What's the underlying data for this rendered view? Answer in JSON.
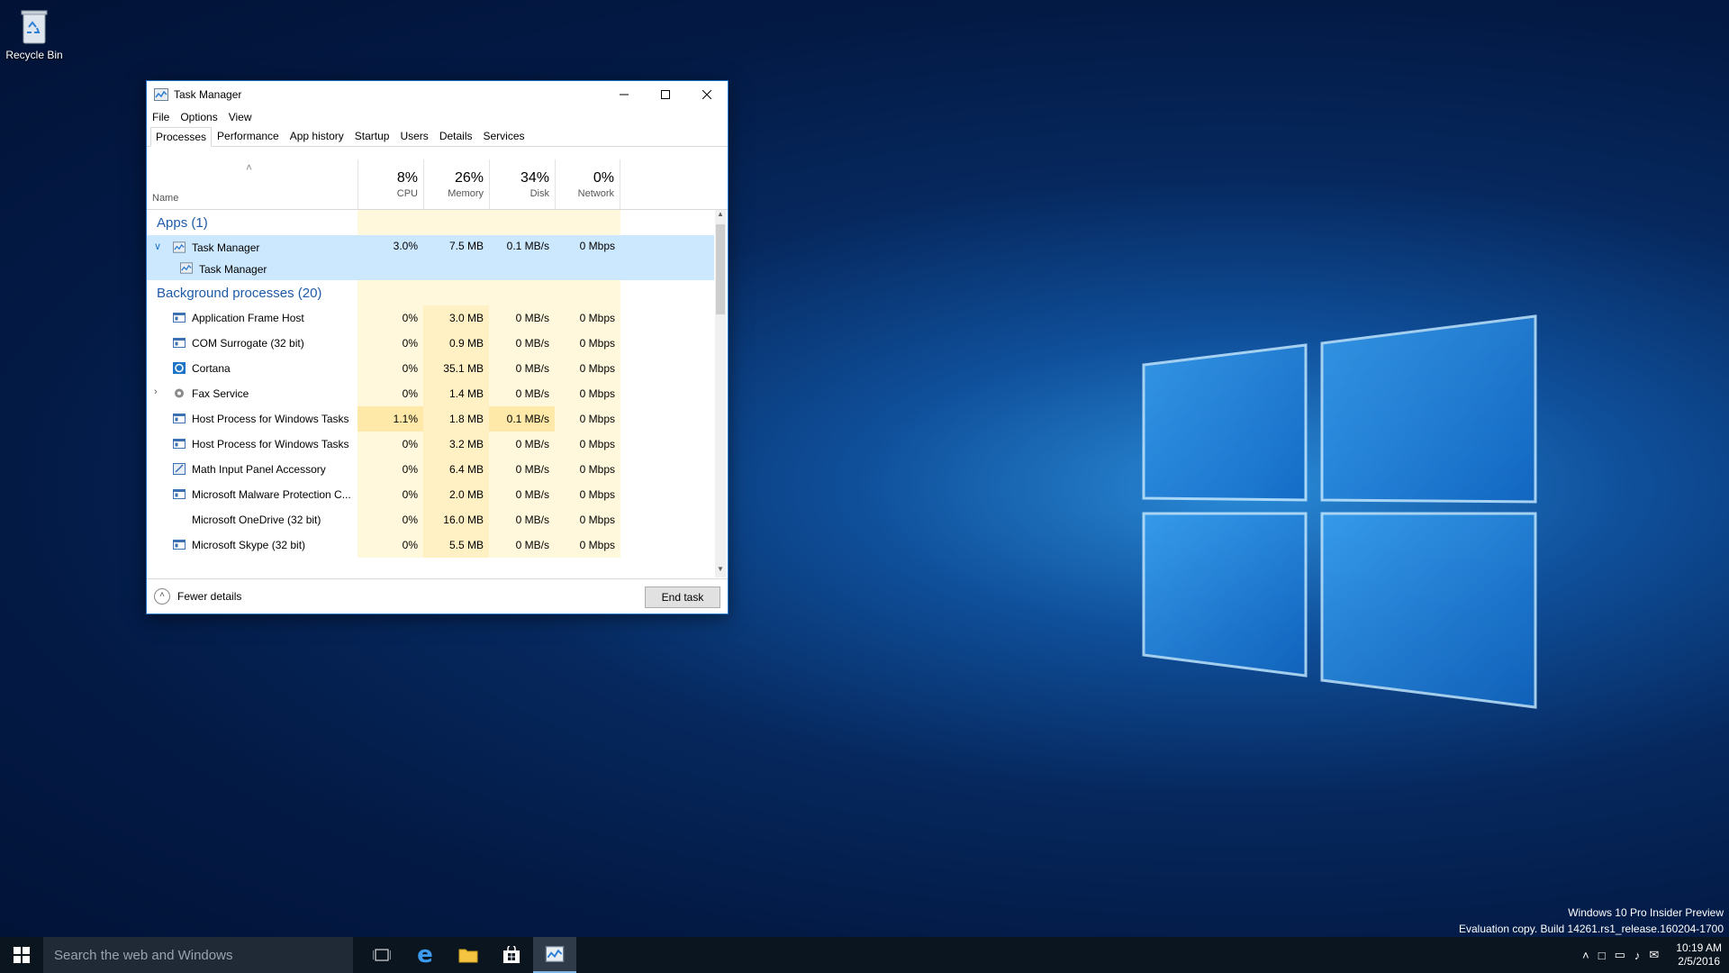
{
  "desktop": {
    "recycle_bin_label": "Recycle Bin",
    "watermark": {
      "line1": "Windows 10 Pro Insider Preview",
      "line2": "Evaluation copy. Build 14261.rs1_release.160204-1700"
    }
  },
  "window": {
    "title": "Task Manager",
    "menu": [
      "File",
      "Options",
      "View"
    ],
    "tabs": [
      "Processes",
      "Performance",
      "App history",
      "Startup",
      "Users",
      "Details",
      "Services"
    ],
    "active_tab": "Processes",
    "columns": {
      "name": "Name",
      "cpu": {
        "pct": "8%",
        "label": "CPU"
      },
      "memory": {
        "pct": "26%",
        "label": "Memory"
      },
      "disk": {
        "pct": "34%",
        "label": "Disk"
      },
      "network": {
        "pct": "0%",
        "label": "Network"
      }
    },
    "groups": {
      "apps": "Apps (1)",
      "background": "Background processes (20)"
    },
    "apps": [
      {
        "name": "Task Manager",
        "cpu": "3.0%",
        "memory": "7.5 MB",
        "disk": "0.1 MB/s",
        "network": "0 Mbps",
        "child": "Task Manager"
      }
    ],
    "background": [
      {
        "name": "Application Frame Host",
        "cpu": "0%",
        "memory": "3.0 MB",
        "disk": "0 MB/s",
        "network": "0 Mbps",
        "icon": "window-icon"
      },
      {
        "name": "COM Surrogate (32 bit)",
        "cpu": "0%",
        "memory": "0.9 MB",
        "disk": "0 MB/s",
        "network": "0 Mbps",
        "icon": "window-icon"
      },
      {
        "name": "Cortana",
        "cpu": "0%",
        "memory": "35.1 MB",
        "disk": "0 MB/s",
        "network": "0 Mbps",
        "icon": "cortana-icon"
      },
      {
        "name": "Fax Service",
        "cpu": "0%",
        "memory": "1.4 MB",
        "disk": "0 MB/s",
        "network": "0 Mbps",
        "icon": "gear-icon",
        "expandable": true
      },
      {
        "name": "Host Process for Windows Tasks",
        "cpu": "1.1%",
        "memory": "1.8 MB",
        "disk": "0.1 MB/s",
        "network": "0 Mbps",
        "icon": "window-icon"
      },
      {
        "name": "Host Process for Windows Tasks",
        "cpu": "0%",
        "memory": "3.2 MB",
        "disk": "0 MB/s",
        "network": "0 Mbps",
        "icon": "window-icon"
      },
      {
        "name": "Math Input Panel Accessory",
        "cpu": "0%",
        "memory": "6.4 MB",
        "disk": "0 MB/s",
        "network": "0 Mbps",
        "icon": "pen-icon"
      },
      {
        "name": "Microsoft Malware Protection C...",
        "cpu": "0%",
        "memory": "2.0 MB",
        "disk": "0 MB/s",
        "network": "0 Mbps",
        "icon": "window-icon"
      },
      {
        "name": "Microsoft OneDrive (32 bit)",
        "cpu": "0%",
        "memory": "16.0 MB",
        "disk": "0 MB/s",
        "network": "0 Mbps",
        "icon": ""
      },
      {
        "name": "Microsoft Skype (32 bit)",
        "cpu": "0%",
        "memory": "5.5 MB",
        "disk": "0 MB/s",
        "network": "0 Mbps",
        "icon": "window-icon"
      }
    ],
    "footer": {
      "fewer_details": "Fewer details",
      "end_task": "End task"
    }
  },
  "taskbar": {
    "search_placeholder": "Search the web and Windows",
    "clock_time": "10:19 AM",
    "clock_date": "2/5/2016"
  },
  "colors": {
    "accent": "#1e5aa8",
    "selected_row": "#cce8ff",
    "heat_light": "#fff8dd",
    "heat_mid": "#fff1c4",
    "heat_hot": "#ffe9a8"
  }
}
